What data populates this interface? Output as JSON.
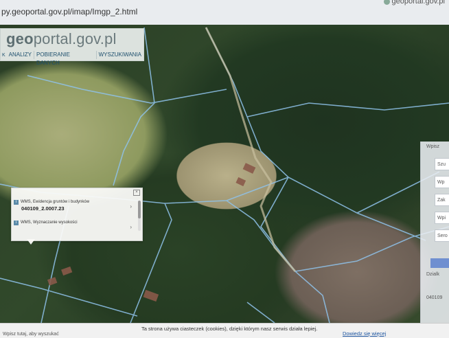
{
  "browser": {
    "url": "py.geoportal.gov.pl/imap/Imgp_2.html",
    "tab_title": "geoportal.gov.pl"
  },
  "header": {
    "logo": {
      "prefix": "geo",
      "rest": "portal.gov.pl"
    },
    "nav_caret": "K",
    "nav": [
      "ANALIZY",
      "POBIERANIE DANYCH",
      "WYSZUKIWANIA"
    ]
  },
  "popup": {
    "rows": [
      {
        "layer": "WMS, Ewidencja gruntów i budynków",
        "value": "040109_2.0007.23"
      },
      {
        "layer": "WMS, Wyznaczanie wysokości",
        "value": ""
      }
    ]
  },
  "side_panel": {
    "labels": [
      "Wpisz",
      "Szu",
      "Wp",
      "Zak",
      "Wpi",
      "Sero",
      "Dzialk",
      "040109"
    ]
  },
  "cookie": {
    "message": "Ta strona używa ciasteczek (cookies), dzięki którym nasz serwis działa lepiej.",
    "more": "Dowiedz się więcej",
    "left": "Wpisz tutaj, aby wyszukać"
  },
  "colors": {
    "parcel_lines": "#8fc2ea",
    "nav_text": "#1d4f6d"
  }
}
